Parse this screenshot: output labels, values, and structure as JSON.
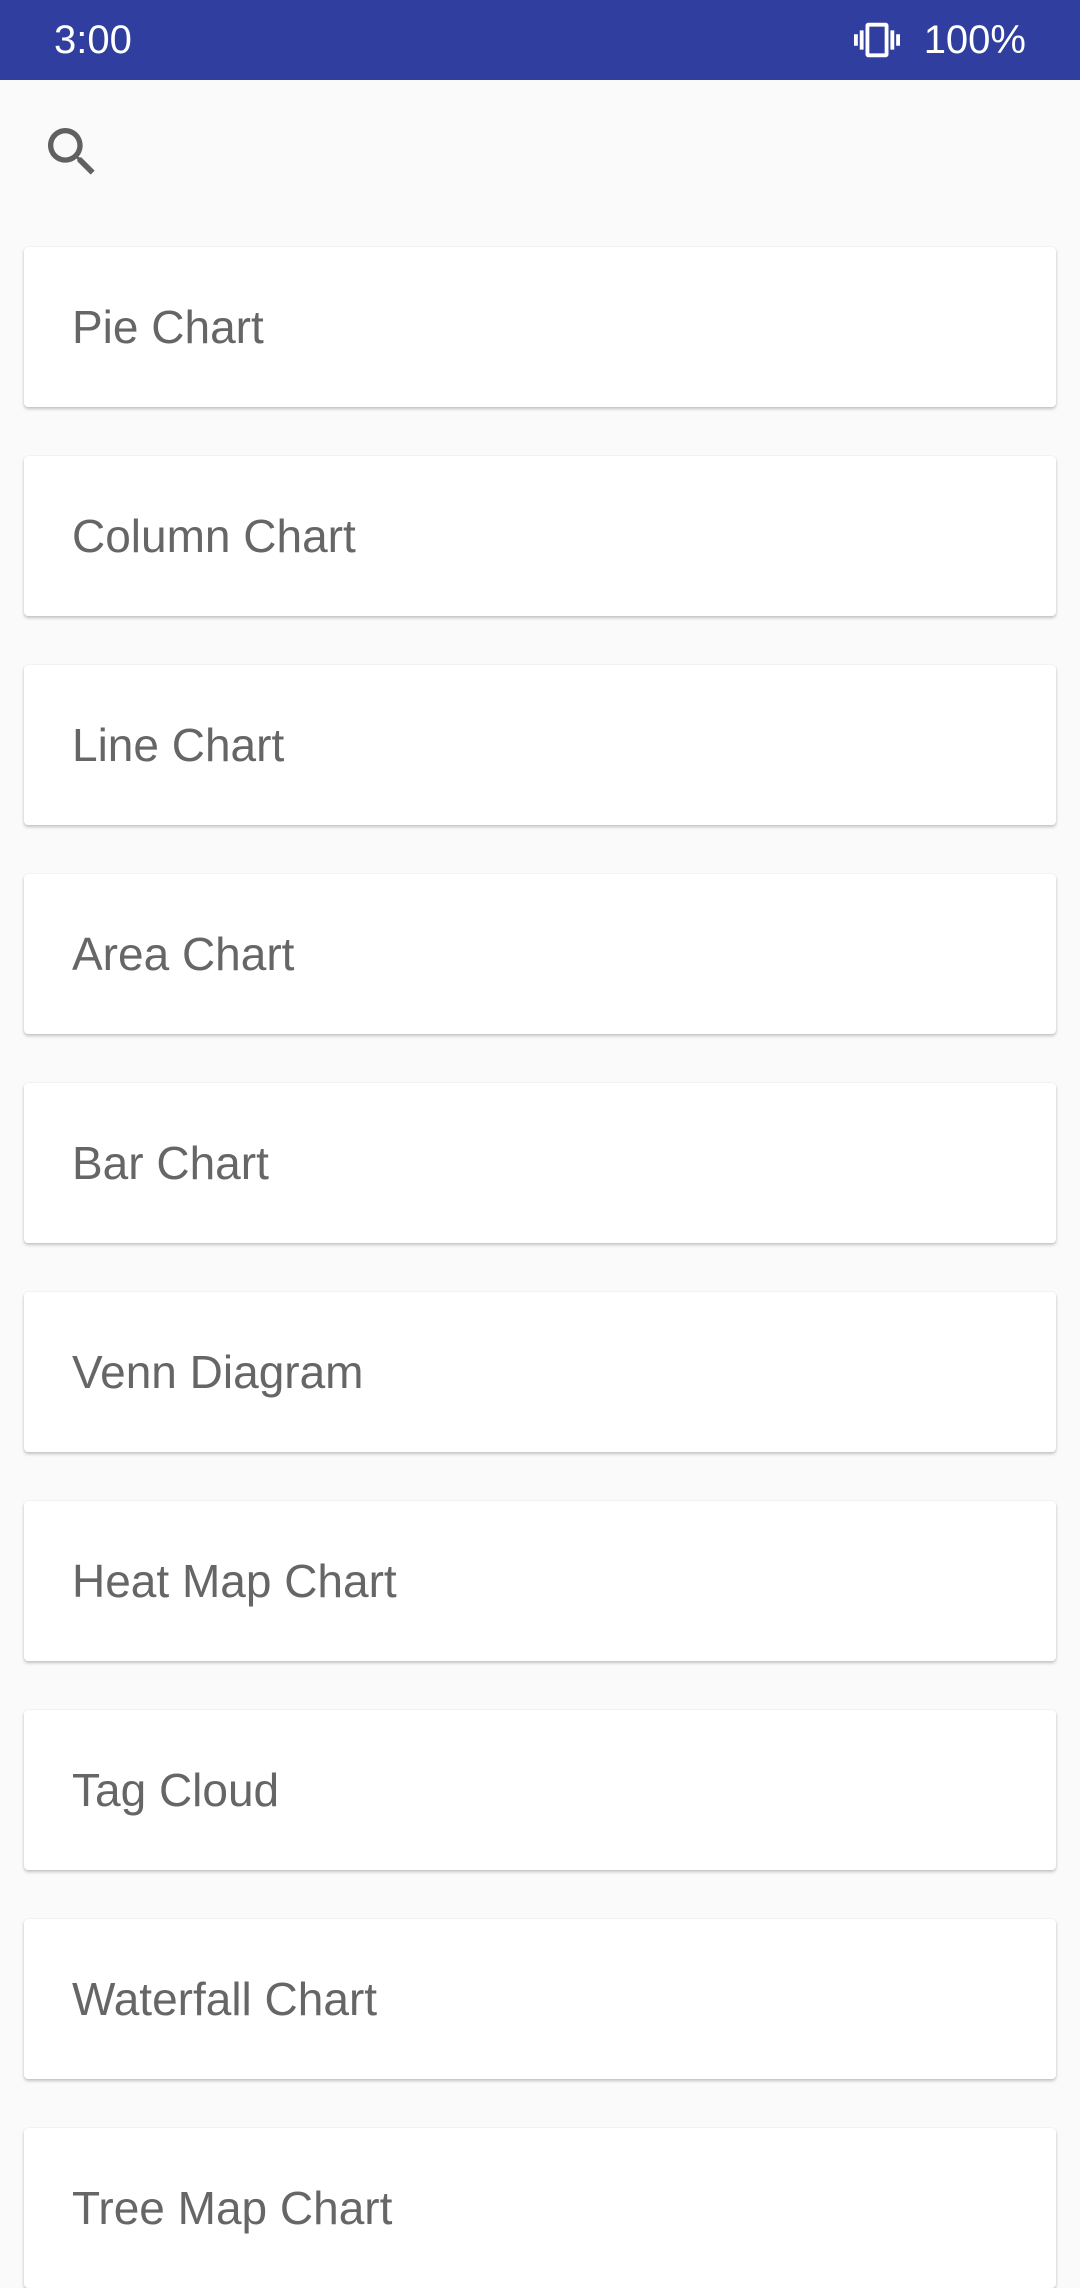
{
  "status_bar": {
    "time": "3:00",
    "battery": "100%",
    "vibrate_icon": "vibrate-icon",
    "background_color": "#303f9f"
  },
  "toolbar": {
    "search_icon": "search-icon"
  },
  "chart_list": {
    "items": [
      {
        "label": "Pie Chart"
      },
      {
        "label": "Column Chart"
      },
      {
        "label": "Line Chart"
      },
      {
        "label": "Area Chart"
      },
      {
        "label": "Bar Chart"
      },
      {
        "label": "Venn Diagram"
      },
      {
        "label": "Heat Map Chart"
      },
      {
        "label": "Tag Cloud"
      },
      {
        "label": "Waterfall Chart"
      },
      {
        "label": "Tree Map Chart"
      }
    ]
  }
}
